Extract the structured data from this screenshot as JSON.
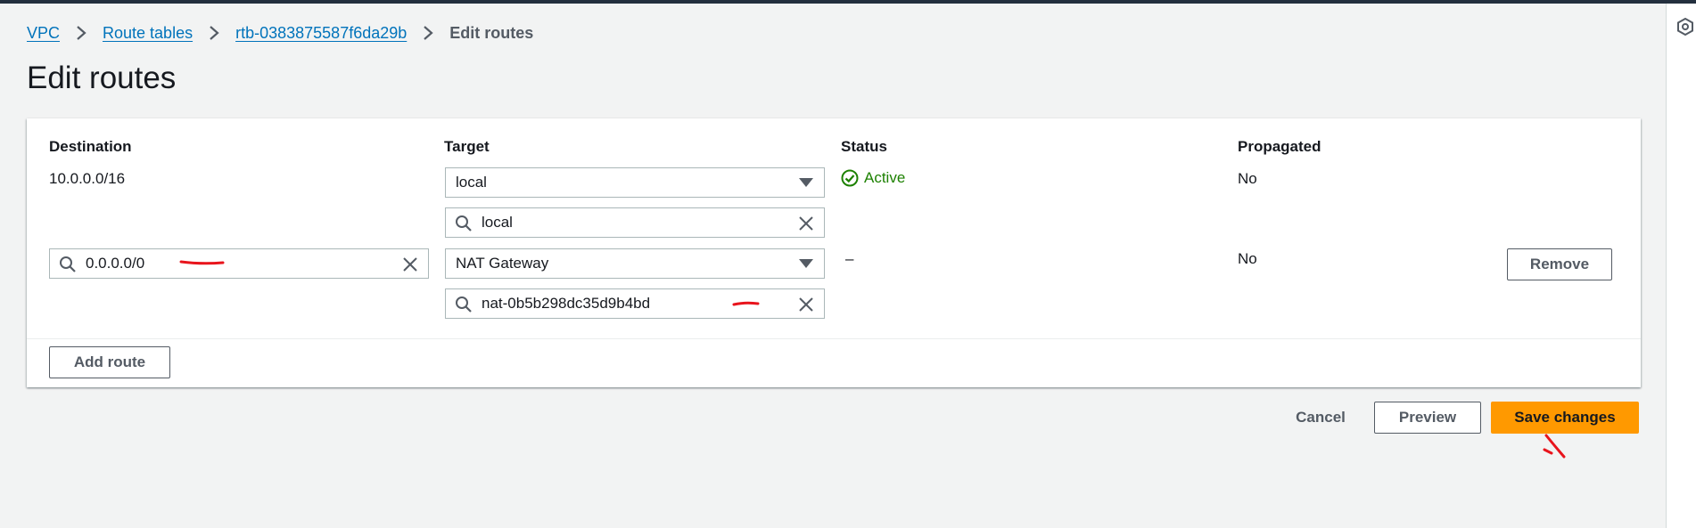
{
  "breadcrumb": {
    "items": [
      "VPC",
      "Route tables",
      "rtb-0383875587f6da29b"
    ],
    "current": "Edit routes"
  },
  "page_title": "Edit routes",
  "table": {
    "headers": {
      "destination": "Destination",
      "target": "Target",
      "status": "Status",
      "propagated": "Propagated"
    },
    "rows": [
      {
        "destination": "10.0.0.0/16",
        "target_type": "local",
        "target_search": "local",
        "status": "Active",
        "propagated": "No"
      },
      {
        "destination": "0.0.0.0/0",
        "target_type": "NAT Gateway",
        "target_search": "nat-0b5b298dc35d9b4bd",
        "status": "–",
        "propagated": "No",
        "remove_label": "Remove"
      }
    ]
  },
  "actions": {
    "add_route": "Add route",
    "cancel": "Cancel",
    "preview": "Preview",
    "save": "Save changes"
  },
  "colors": {
    "link": "#0073bb",
    "primary": "#ff9900",
    "success": "#1d8102",
    "annotation": "#e8141c"
  },
  "icons": [
    "chevron-right-icon",
    "search-icon",
    "close-icon",
    "caret-down-icon",
    "check-circle-icon"
  ]
}
